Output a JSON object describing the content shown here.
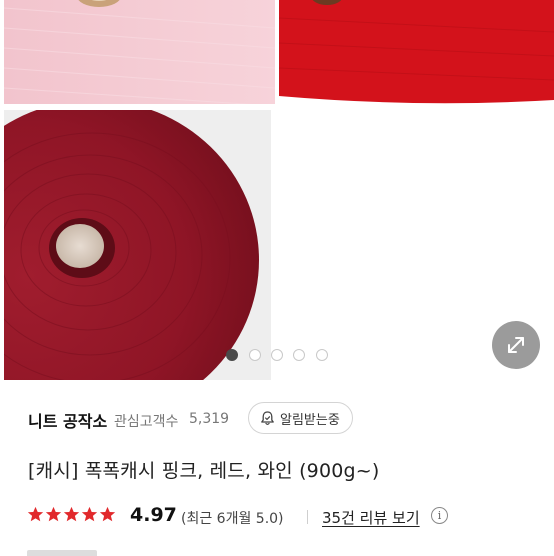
{
  "gallery": {
    "images": [
      {
        "name": "pink-yarn-cone",
        "color": "#f4c9d2"
      },
      {
        "name": "red-yarn-cone",
        "color": "#d3121b"
      },
      {
        "name": "wine-yarn-cone",
        "color": "#8f1526"
      }
    ],
    "dots": {
      "count": 5,
      "active_index": 0
    },
    "expand_icon": "expand-arrows-icon"
  },
  "store": {
    "name": "니트 공작소",
    "favorites_label": "관심고객수",
    "favorites_count": "5,319",
    "notify_label": "알림받는중",
    "notify_icon": "bell-icon"
  },
  "product": {
    "title": "[캐시] 폭폭캐시 핑크, 레드, 와인 (900g~)"
  },
  "rating": {
    "stars": 5,
    "star_color": "#e1292c",
    "value": "4.97",
    "recent_text": "(최근 6개월 5.0)",
    "reviews_link": "35건 리뷰 보기",
    "info_icon": "info-icon",
    "info_glyph": "i"
  }
}
